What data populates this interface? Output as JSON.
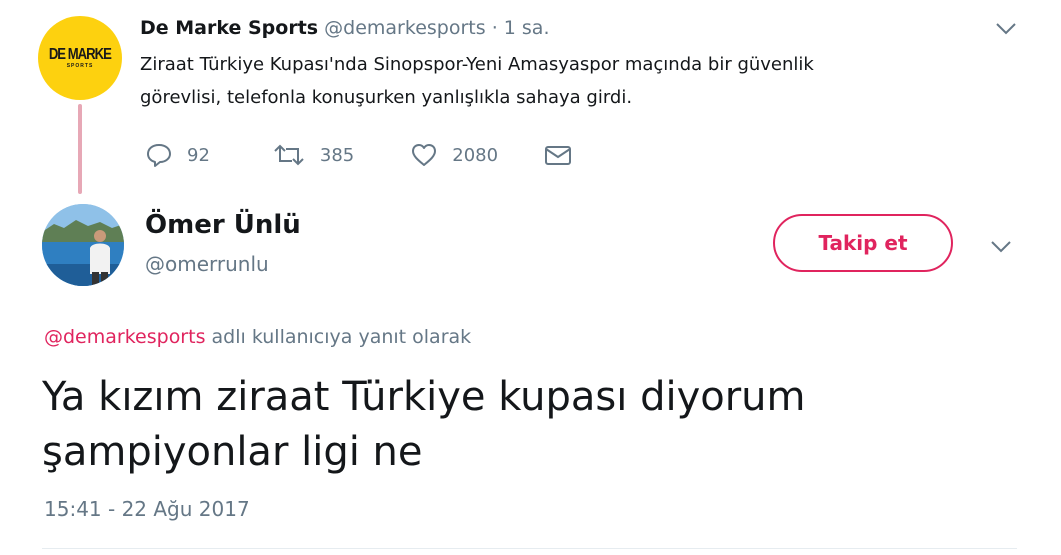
{
  "parent_tweet": {
    "avatar_logo_main": "DE MARKE",
    "avatar_logo_sub": "SPORTS",
    "name": "De Marke Sports",
    "handle": "@demarkesports",
    "separator": "·",
    "time": "1 sa.",
    "text_line1": "Ziraat Türkiye Kupası'nda Sinopspor-Yeni Amasyaspor maçında bir güvenlik",
    "text_line2": "görevlisi, telefonla konuşurken yanlışlıkla sahaya girdi.",
    "actions": {
      "replies": "92",
      "retweets": "385",
      "likes": "2080"
    },
    "icons": {
      "reply": "reply-icon",
      "retweet": "retweet-icon",
      "like": "heart-icon",
      "dm": "envelope-icon",
      "menu": "chevron-down-icon"
    }
  },
  "reply_tweet": {
    "name": "Ömer Ünlü",
    "handle": "@omerrunlu",
    "follow_label": "Takip et",
    "reply_to_mention": "@demarkesports",
    "reply_to_suffix": " adlı kullanıcıya yanıt olarak",
    "text_line1": "Ya kızım ziraat Türkiye kupası diyorum",
    "text_line2": "şampiyonlar ligi ne",
    "timestamp": "15:41 - 22 Ağu 2017"
  },
  "colors": {
    "accent": "#e0245e",
    "muted": "#657786",
    "text": "#14171a",
    "thread_line": "#e7a8b6",
    "logo_yellow": "#fdd10f"
  }
}
